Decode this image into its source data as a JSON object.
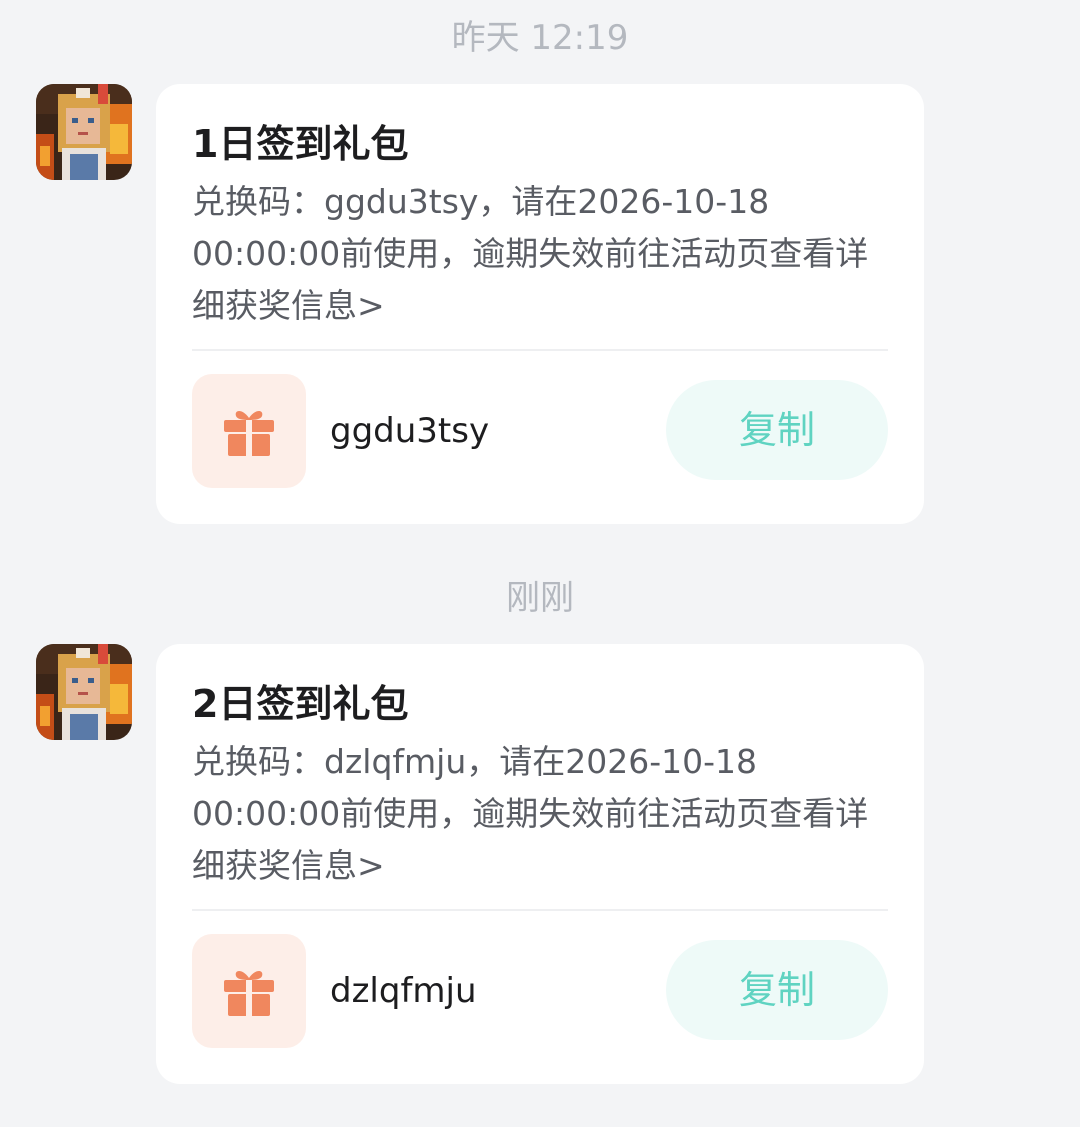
{
  "messages": [
    {
      "timestamp": "昨天  12:19",
      "title": "1日签到礼包",
      "description": "兑换码：ggdu3tsy，请在2026-10-18 00:00:00前使用，逾期失效前往活动页查看详细获奖信息>",
      "code": "ggdu3tsy",
      "copy_label": "复制"
    },
    {
      "timestamp": "刚刚",
      "title": "2日签到礼包",
      "description": "兑换码：dzlqfmju，请在2026-10-18 00:00:00前使用，逾期失效前往活动页查看详细获奖信息>",
      "code": "dzlqfmju",
      "copy_label": "复制"
    }
  ],
  "icons": {
    "gift": "gift-icon",
    "avatar": "game-avatar"
  },
  "colors": {
    "background": "#f3f4f6",
    "accent": "#5fd3c1",
    "gift": "#f0875e",
    "gift_bg": "#fdeee8"
  }
}
